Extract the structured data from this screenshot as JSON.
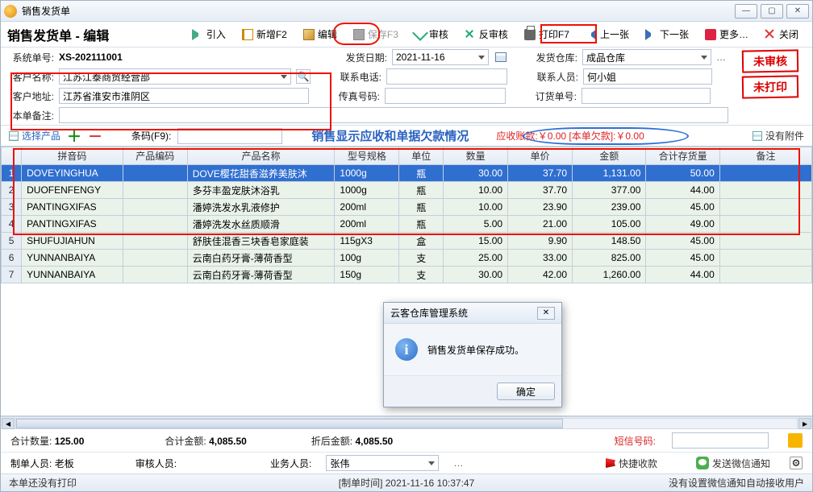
{
  "window": {
    "title": "销售发货单"
  },
  "page": {
    "title": "销售发货单 - 编辑"
  },
  "toolbar": {
    "import": "引入",
    "new": "新增F2",
    "edit": "编辑",
    "save": "保存F3",
    "audit": "审核",
    "unaudit": "反审核",
    "print": "打印F7",
    "prev": "上一张",
    "next": "下一张",
    "more": "更多…",
    "close": "关闭"
  },
  "form": {
    "sys_no_label": "系统单号:",
    "sys_no": "XS-202111001",
    "ship_date_label": "发货日期:",
    "ship_date": "2021-11-16",
    "warehouse_label": "发货仓库:",
    "warehouse": "成品仓库",
    "cust_name_label": "客户名称:",
    "cust_name": "江苏江泰商贸经营部",
    "phone_label": "联系电话:",
    "phone": "",
    "contact_label": "联系人员:",
    "contact": "何小姐",
    "cust_addr_label": "客户地址:",
    "cust_addr": "江苏省淮安市淮阴区",
    "fax_label": "传真号码:",
    "fax": "",
    "order_no_label": "订货单号:",
    "order_no": "",
    "remark_label": "本单备注:",
    "remark": ""
  },
  "stamps": {
    "unaudited": "未审核",
    "unprinted": "未打印"
  },
  "prodbar": {
    "select": "选择产品",
    "barcode_label": "条码(F9):",
    "barcode": "",
    "banner": "销售显示应收和单据欠款情况",
    "ar": "应收账款:￥0.00 [本单欠款]:￥0.00",
    "noattach": "没有附件"
  },
  "columns": [
    "",
    "拼音码",
    "产品编码",
    "产品名称",
    "型号规格",
    "单位",
    "数量",
    "单价",
    "金额",
    "合计存货量",
    "备注"
  ],
  "rows": [
    {
      "n": "1",
      "py": "DOVEYINGHUA",
      "code": "",
      "name": "DOVE樱花甜香滋养美肤沐",
      "spec": "1000g",
      "unit": "瓶",
      "qty": "30.00",
      "price": "37.70",
      "amt": "1,131.00",
      "stock": "50.00",
      "remark": ""
    },
    {
      "n": "2",
      "py": "DUOFENFENGY",
      "code": "",
      "name": "多芬丰盈宠肤沐浴乳",
      "spec": "1000g",
      "unit": "瓶",
      "qty": "10.00",
      "price": "37.70",
      "amt": "377.00",
      "stock": "44.00",
      "remark": ""
    },
    {
      "n": "3",
      "py": "PANTINGXIFAS",
      "code": "",
      "name": "潘婷洗发水乳液修护",
      "spec": "200ml",
      "unit": "瓶",
      "qty": "10.00",
      "price": "23.90",
      "amt": "239.00",
      "stock": "45.00",
      "remark": ""
    },
    {
      "n": "4",
      "py": "PANTINGXIFAS",
      "code": "",
      "name": "潘婷洗发水丝质顺滑",
      "spec": "200ml",
      "unit": "瓶",
      "qty": "5.00",
      "price": "21.00",
      "amt": "105.00",
      "stock": "49.00",
      "remark": ""
    },
    {
      "n": "5",
      "py": "SHUFUJIAHUN",
      "code": "",
      "name": "舒肤佳混香三块香皂家庭装",
      "spec": "115gX3",
      "unit": "盒",
      "qty": "15.00",
      "price": "9.90",
      "amt": "148.50",
      "stock": "45.00",
      "remark": ""
    },
    {
      "n": "6",
      "py": "YUNNANBAIYA",
      "code": "",
      "name": "云南白药牙膏-薄荷香型",
      "spec": "100g",
      "unit": "支",
      "qty": "25.00",
      "price": "33.00",
      "amt": "825.00",
      "stock": "45.00",
      "remark": ""
    },
    {
      "n": "7",
      "py": "YUNNANBAIYA",
      "code": "",
      "name": "云南白药牙膏-薄荷香型",
      "spec": "150g",
      "unit": "支",
      "qty": "30.00",
      "price": "42.00",
      "amt": "1,260.00",
      "stock": "44.00",
      "remark": ""
    }
  ],
  "totals": {
    "qty_label": "合计数量:",
    "qty": "125.00",
    "amt_label": "合计金额:",
    "amt": "4,085.50",
    "disc_label": "折后金额:",
    "disc": "4,085.50",
    "sms_label": "短信号码:",
    "sms": ""
  },
  "footer": {
    "maker_label": "制单人员:",
    "maker": "老板",
    "auditor_label": "审核人员:",
    "auditor": "",
    "sales_label": "业务人员:",
    "sales": "张伟",
    "quickpay": "快捷收款",
    "wechat": "发送微信通知"
  },
  "status": {
    "left": "本单还没有打印",
    "mid": "[制单时间]  2021-11-16 10:37:47",
    "right": "没有设置微信通知自动接收用户"
  },
  "dialog": {
    "title": "云客仓库管理系统",
    "msg": "销售发货单保存成功。",
    "ok": "确定"
  }
}
